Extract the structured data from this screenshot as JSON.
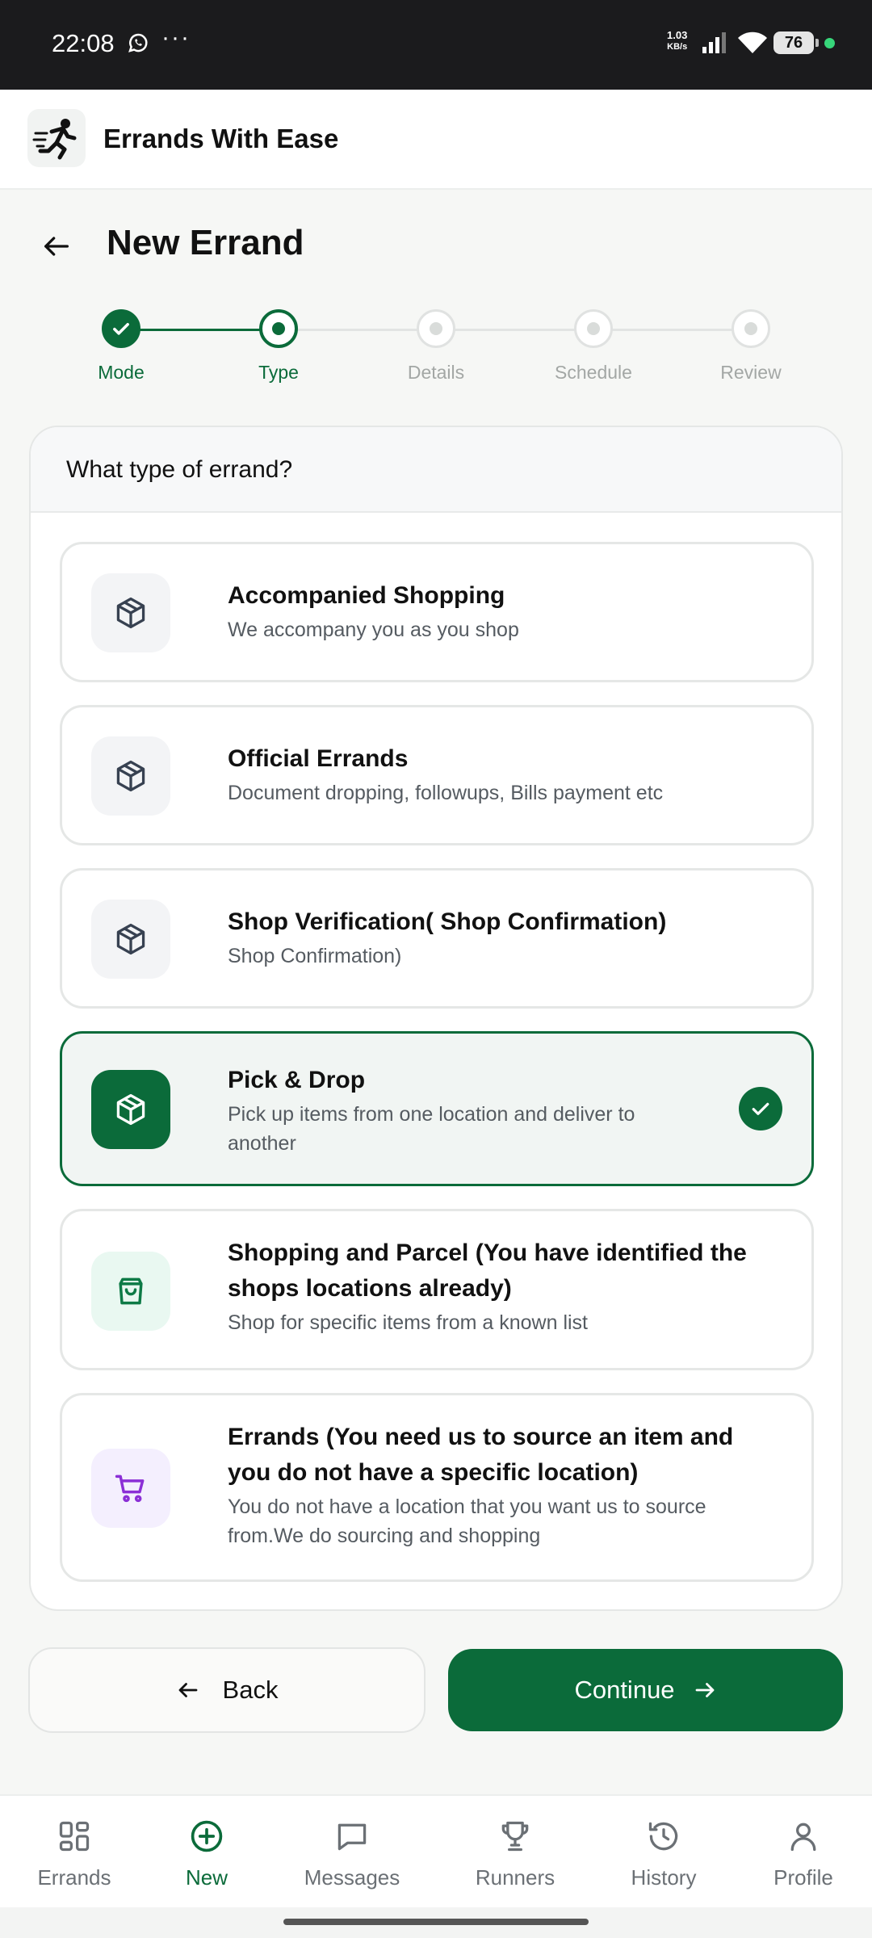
{
  "status_bar": {
    "time": "22:08",
    "more": "···",
    "net_speed_value": "1.03",
    "net_speed_unit": "KB/s",
    "battery": "76",
    "icons": [
      "whatsapp-icon",
      "signal-icon",
      "wifi-icon",
      "battery-icon"
    ]
  },
  "app": {
    "title": "Errands With Ease",
    "logo": "runner-logo-icon"
  },
  "page": {
    "title": "New Errand",
    "back_icon": "arrow-left-icon"
  },
  "stepper": {
    "steps": [
      {
        "label": "Mode",
        "state": "done"
      },
      {
        "label": "Type",
        "state": "current"
      },
      {
        "label": "Details",
        "state": "upcoming"
      },
      {
        "label": "Schedule",
        "state": "upcoming"
      },
      {
        "label": "Review",
        "state": "upcoming"
      }
    ]
  },
  "card": {
    "title": "What type of errand?",
    "options": [
      {
        "title": "Accompanied Shopping",
        "desc": "We accompany you as you shop",
        "icon": "package-icon",
        "selected": false
      },
      {
        "title": "Official Errands",
        "desc": "Document dropping, followups, Bills payment etc",
        "icon": "package-icon",
        "selected": false
      },
      {
        "title": "Shop Verification( Shop Confirmation)",
        "desc": "Shop Confirmation)",
        "icon": "package-icon",
        "selected": false
      },
      {
        "title": "Pick & Drop",
        "desc": "Pick up items from one location and deliver to another",
        "icon": "package-icon",
        "selected": true
      },
      {
        "title": "Shopping and Parcel (You have identified the shops locations already)",
        "desc": "Shop for specific items from a known list",
        "icon": "shopping-bag-icon",
        "selected": false
      },
      {
        "title": "Errands (You need us to source an item and you do not have a specific location)",
        "desc": "You do not have a location that you want us to source from.We do sourcing and shopping",
        "icon": "shopping-cart-icon",
        "selected": false
      }
    ]
  },
  "actions": {
    "back_label": "Back",
    "continue_label": "Continue"
  },
  "bottom_nav": {
    "items": [
      {
        "label": "Errands",
        "icon": "grid-icon",
        "active": false
      },
      {
        "label": "New",
        "icon": "plus-circle-icon",
        "active": true
      },
      {
        "label": "Messages",
        "icon": "message-icon",
        "active": false
      },
      {
        "label": "Runners",
        "icon": "trophy-icon",
        "active": false
      },
      {
        "label": "History",
        "icon": "history-icon",
        "active": false
      },
      {
        "label": "Profile",
        "icon": "user-icon",
        "active": false
      }
    ]
  },
  "colors": {
    "brand_green": "#0b6b3a",
    "status_bar_bg": "#1b1b1d",
    "page_bg": "#f6f7f5"
  }
}
